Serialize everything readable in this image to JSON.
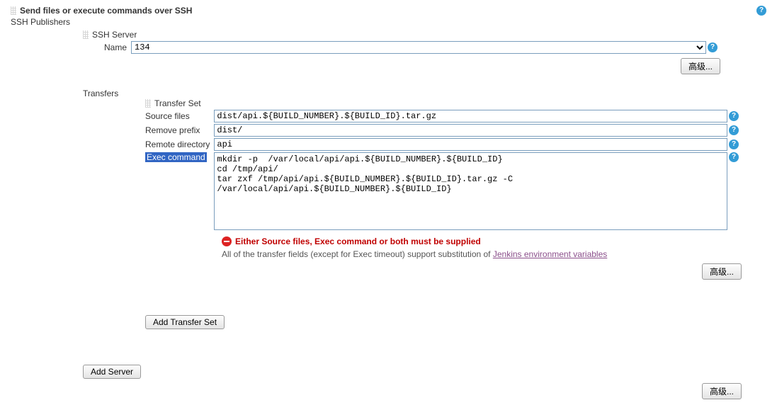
{
  "section": {
    "title": "Send files or execute commands over SSH",
    "publishers_label": "SSH Publishers",
    "transfers_label": "Transfers"
  },
  "ssh_server": {
    "heading": "SSH Server",
    "name_label": "Name",
    "name_value": "134",
    "advanced_btn": "高级..."
  },
  "transfer_set": {
    "heading": "Transfer Set",
    "source_label": "Source files",
    "source_value": "dist/api.${BUILD_NUMBER}.${BUILD_ID}.tar.gz",
    "remove_prefix_label": "Remove prefix",
    "remove_prefix_value": "dist/",
    "remote_dir_label": "Remote directory",
    "remote_dir_value": "api",
    "exec_label": "Exec command",
    "exec_value": "mkdir -p  /var/local/api/api.${BUILD_NUMBER}.${BUILD_ID}\ncd /tmp/api/\ntar zxf /tmp/api/api.${BUILD_NUMBER}.${BUILD_ID}.tar.gz -C /var/local/api/api.${BUILD_NUMBER}.${BUILD_ID}",
    "error_msg": "Either Source files, Exec command or both must be supplied",
    "info_text_prefix": "All of the transfer fields (except for Exec timeout) support substitution of ",
    "info_link": "Jenkins environment variables",
    "advanced_btn": "高级..."
  },
  "buttons": {
    "add_transfer": "Add Transfer Set",
    "add_server": "Add Server",
    "bottom_advanced": "高级..."
  }
}
